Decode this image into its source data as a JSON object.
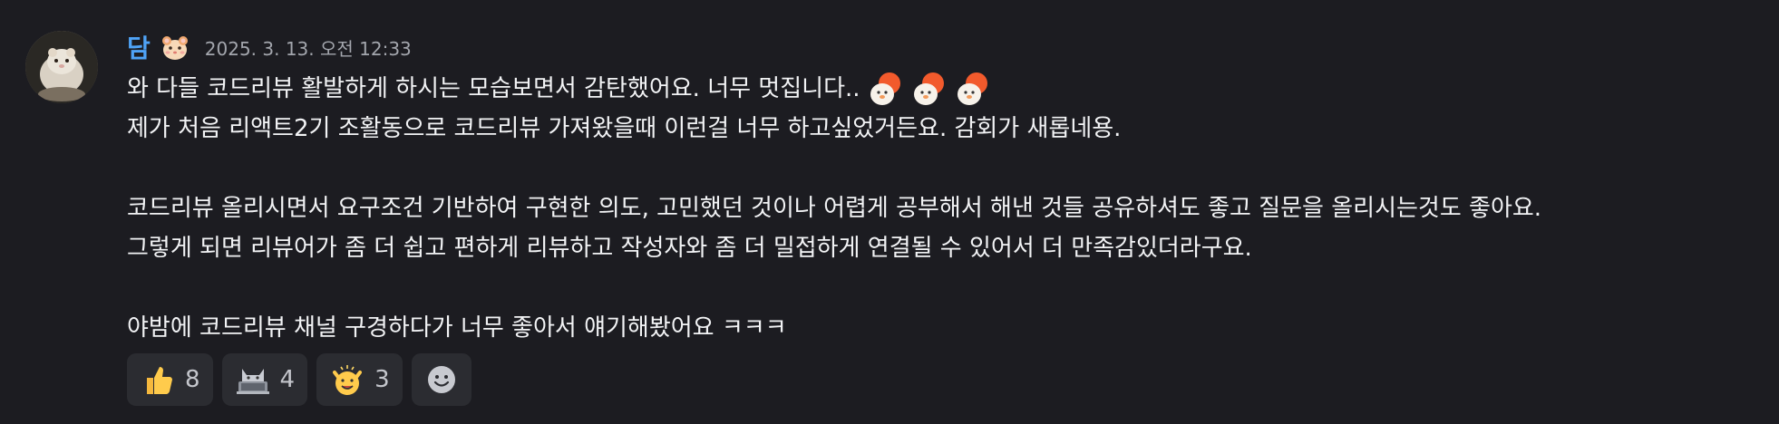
{
  "message": {
    "author": "담",
    "author_badge": "hamster-emoji",
    "timestamp": "2025. 3. 13. 오전 12:33",
    "lines": [
      "와 다들 코드리뷰 활발하게 하시는 모습보면서 감탄했어요. 너무 멋집니다..",
      "제가 처음 리액트2기 조활동으로 코드리뷰 가져왔을때 이런걸 너무 하고싶었거든요. 감회가 새롭네용.",
      "",
      "코드리뷰 올리시면서 요구조건 기반하여 구현한 의도, 고민했던 것이나 어렵게 공부해서 해낸 것들 공유하셔도 좋고 질문을 올리시는것도 좋아요.",
      "그렇게 되면 리뷰어가 좀 더 쉽고 편하게 리뷰하고 작성자와 좀 더 밀접하게 연결될 수 있어서 더 만족감있더라구요.",
      "",
      "야밤에 코드리뷰 채널 구경하다가 너무 좋아서 얘기해봤어요 ㅋㅋㅋ"
    ],
    "inline_emotes": [
      "clapping-chick-emote",
      "clapping-chick-emote",
      "clapping-chick-emote"
    ]
  },
  "reactions": [
    {
      "icon": "thumbs-up-icon",
      "count": "8"
    },
    {
      "icon": "cat-laptop-emote",
      "count": "4"
    },
    {
      "icon": "cheering-emote",
      "count": "3"
    }
  ],
  "add_reaction_icon": "add-reaction-smiley-icon"
}
